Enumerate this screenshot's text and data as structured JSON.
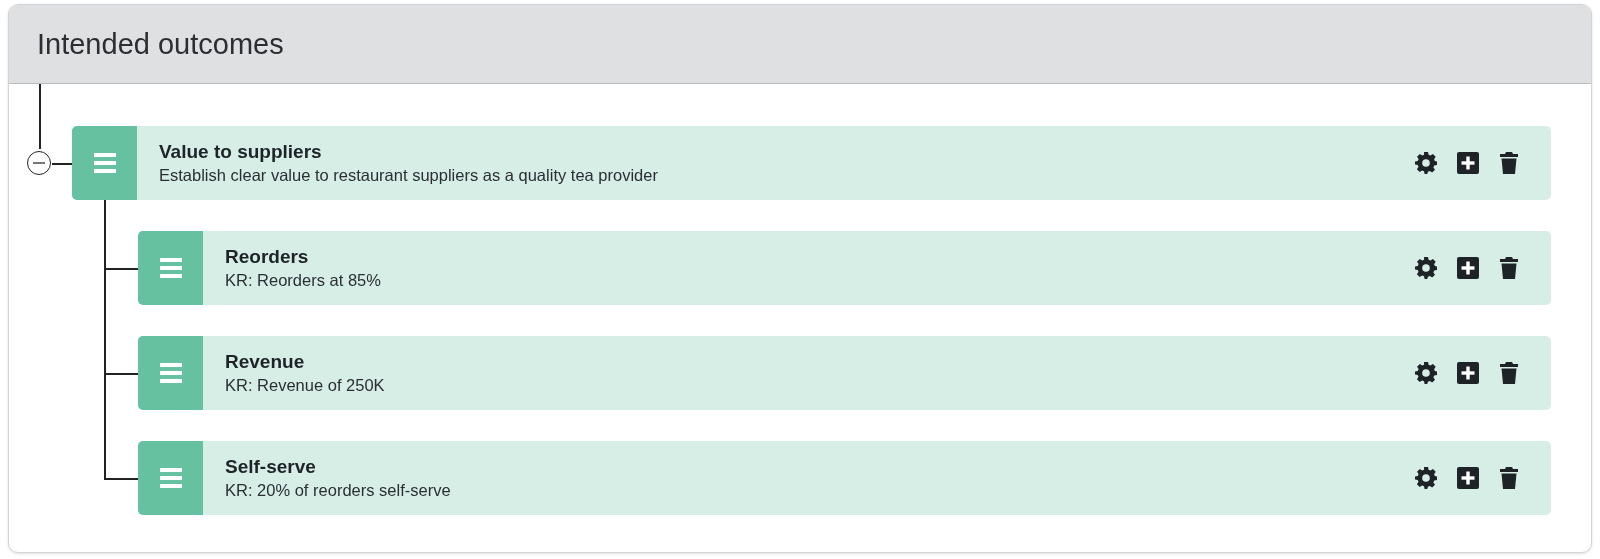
{
  "panel": {
    "title": "Intended outcomes"
  },
  "outcomes": [
    {
      "title": "Value to suppliers",
      "description": "Establish clear value to restaurant suppliers as a quality tea provider",
      "expanded": true,
      "children": [
        {
          "title": "Reorders",
          "description": "KR: Reorders at 85%"
        },
        {
          "title": "Revenue",
          "description": "KR: Revenue of 250K"
        },
        {
          "title": "Self-serve",
          "description": "KR: 20% of reorders self-serve"
        }
      ]
    }
  ]
}
